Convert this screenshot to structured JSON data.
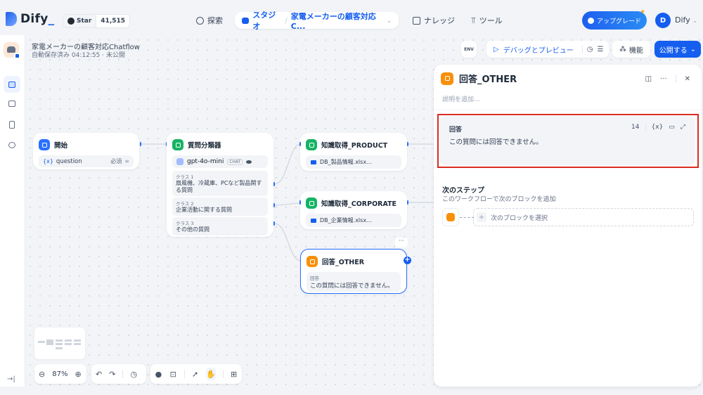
{
  "header": {
    "brand": "Dify",
    "github": {
      "label": "Star",
      "count": "41,515"
    },
    "nav": {
      "explore": "探索",
      "studio": "スタジオ",
      "separator": "/",
      "current_app": "家電メーカーの顧客対応C...",
      "knowledge": "ナレッジ",
      "tools": "ツール"
    },
    "upgrade_label": "アップグレード",
    "user": {
      "initial": "D",
      "name": "Dify"
    }
  },
  "app": {
    "title": "家電メーカーの顧客対応Chatflow",
    "status": "自動保存済み 04:12:55 · 未公開"
  },
  "toolbar": {
    "env_label": "ENV",
    "debug_label": "デバッグとプレビュー",
    "features_label": "機能",
    "publish_label": "公開する"
  },
  "nodes": {
    "start": {
      "title": "開始",
      "var_icon": "{x}",
      "variable": "question",
      "required": "必須"
    },
    "classifier": {
      "title": "質問分類器",
      "model": "gpt-4o-mini",
      "model_tag": "CHAT",
      "classes": [
        {
          "label": "クラス 1",
          "text": "扇風機、冷蔵庫、PCなど製品関する質問"
        },
        {
          "label": "クラス 2",
          "text": "企業活動に関する質問"
        },
        {
          "label": "クラス 3",
          "text": "その他の質問"
        }
      ]
    },
    "kb_product": {
      "title": "知識取得_PRODUCT",
      "dataset": "DB_製品情報.xlsx..."
    },
    "kb_corporate": {
      "title": "知識取得_CORPORATE",
      "dataset": "DB_企業情報.xlsx..."
    },
    "answer_other": {
      "title": "回答_OTHER",
      "label": "回答",
      "text": "この質問には回答できません。"
    }
  },
  "canvas": {
    "zoom": "87%"
  },
  "panel": {
    "title": "回答_OTHER",
    "description_placeholder": "説明を追加...",
    "answer": {
      "label": "回答",
      "text": "この質問には回答できません。",
      "char_count": "14",
      "var_icon": "{x}"
    },
    "next_step": {
      "title": "次のステップ",
      "subtitle": "このワークフローで次のブロックを追加",
      "select_label": "次のブロックを選択"
    }
  }
}
